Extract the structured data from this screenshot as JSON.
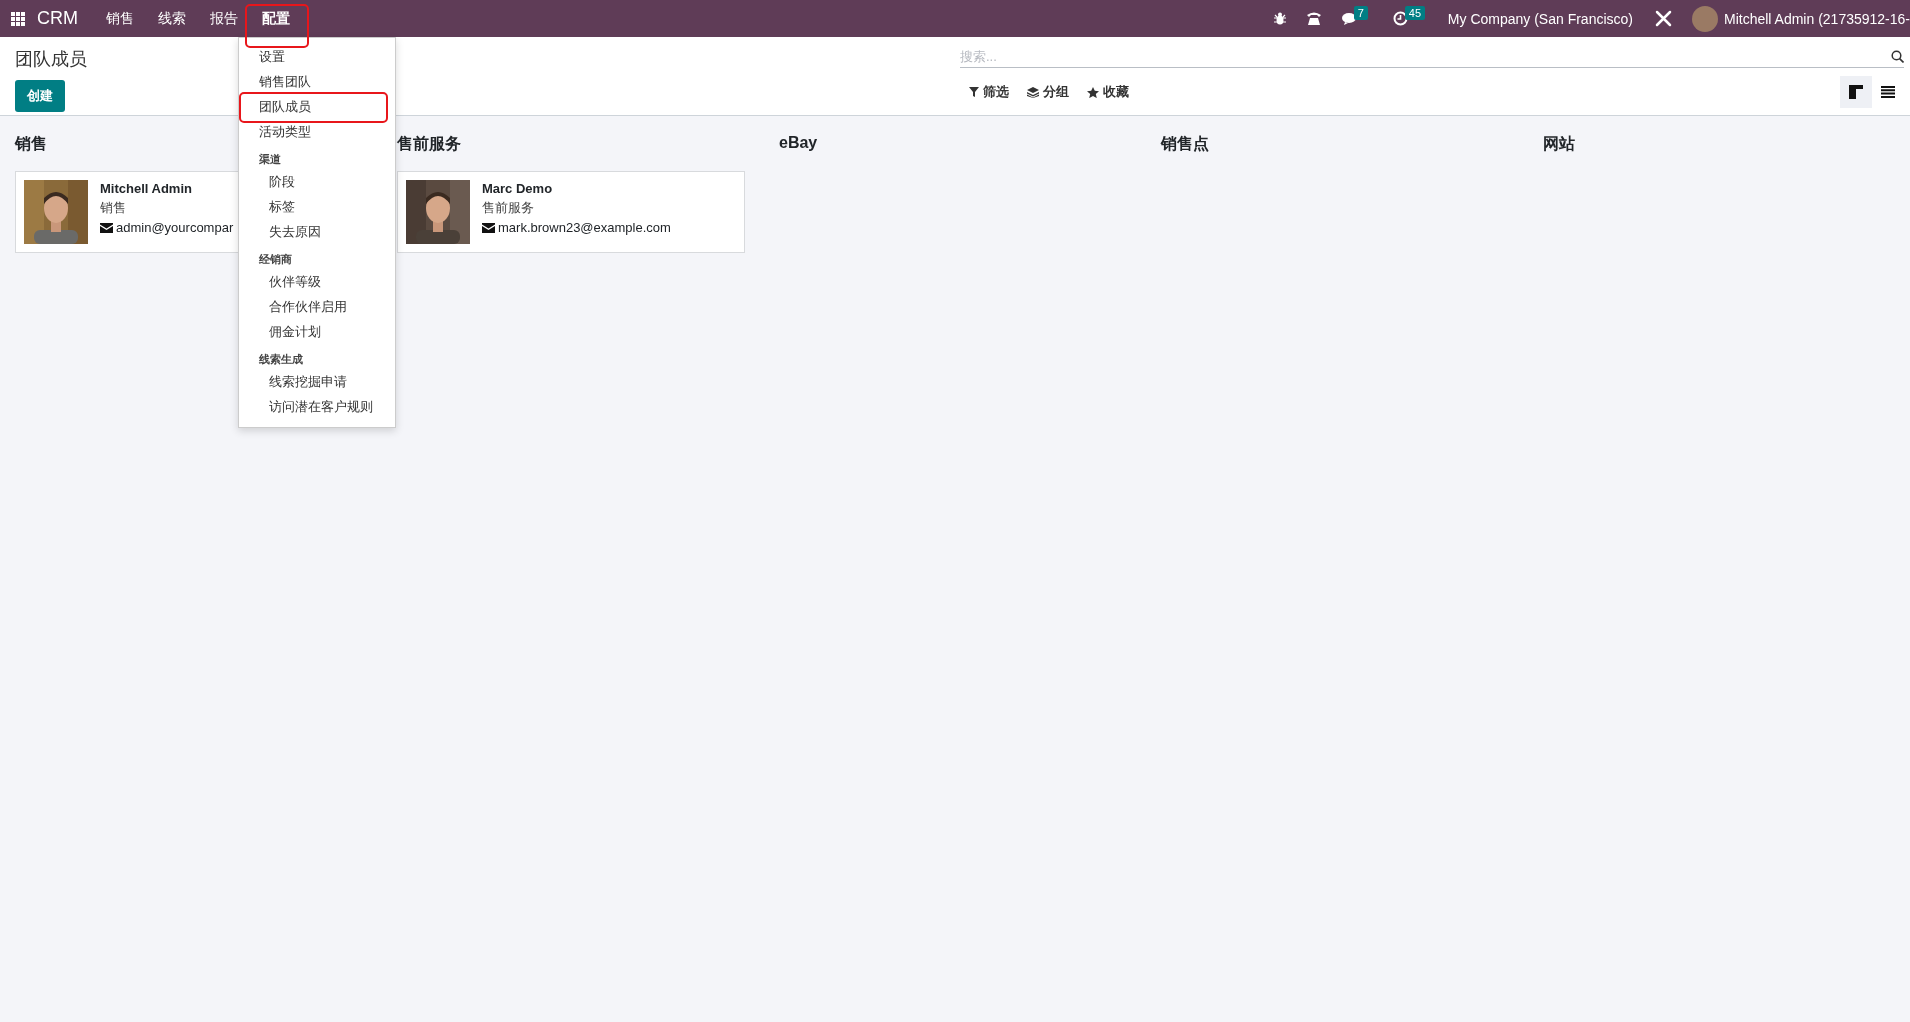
{
  "navbar": {
    "app_name": "CRM",
    "menus": [
      {
        "label": "销售",
        "highlighted": false
      },
      {
        "label": "线索",
        "highlighted": false
      },
      {
        "label": "报告",
        "highlighted": false
      },
      {
        "label": "配置",
        "highlighted": true
      }
    ],
    "messages_count": "7",
    "activities_count": "45",
    "company": "My Company (San Francisco)",
    "user": "Mitchell Admin (21735912-16-"
  },
  "dropdown": {
    "sections": [
      {
        "items": [
          {
            "label": "设置",
            "highlighted": false
          },
          {
            "label": "销售团队",
            "highlighted": false
          },
          {
            "label": "团队成员",
            "highlighted": true
          },
          {
            "label": "活动类型",
            "highlighted": false
          }
        ]
      },
      {
        "header": "渠道",
        "items": [
          {
            "label": "阶段",
            "highlighted": false
          },
          {
            "label": "标签",
            "highlighted": false
          },
          {
            "label": "失去原因",
            "highlighted": false
          }
        ]
      },
      {
        "header": "经销商",
        "items": [
          {
            "label": "伙伴等级",
            "highlighted": false
          },
          {
            "label": "合作伙伴启用",
            "highlighted": false
          },
          {
            "label": "佣金计划",
            "highlighted": false
          }
        ]
      },
      {
        "header": "线索生成",
        "items": [
          {
            "label": "线索挖掘申请",
            "highlighted": false
          },
          {
            "label": "访问潜在客户规则",
            "highlighted": false
          }
        ]
      }
    ]
  },
  "page": {
    "title": "团队成员",
    "create_button": "创建",
    "search": {
      "placeholder": "搜索..."
    },
    "filters": [
      {
        "kind": "filter",
        "label": "筛选"
      },
      {
        "kind": "group",
        "label": "分组"
      },
      {
        "kind": "favorite",
        "label": "收藏"
      }
    ],
    "views": [
      {
        "kind": "kanban",
        "selected": true
      },
      {
        "kind": "list",
        "selected": false
      }
    ]
  },
  "columns": [
    {
      "title": "销售",
      "cards": [
        {
          "name": "Mitchell Admin",
          "team": "销售",
          "email": "admin@yourcompar"
        }
      ]
    },
    {
      "title": "售前服务",
      "cards": [
        {
          "name": "Marc Demo",
          "team": "售前服务",
          "email": "mark.brown23@example.com"
        }
      ]
    },
    {
      "title": "eBay"
    },
    {
      "title": "销售点"
    },
    {
      "title": "网站"
    }
  ]
}
